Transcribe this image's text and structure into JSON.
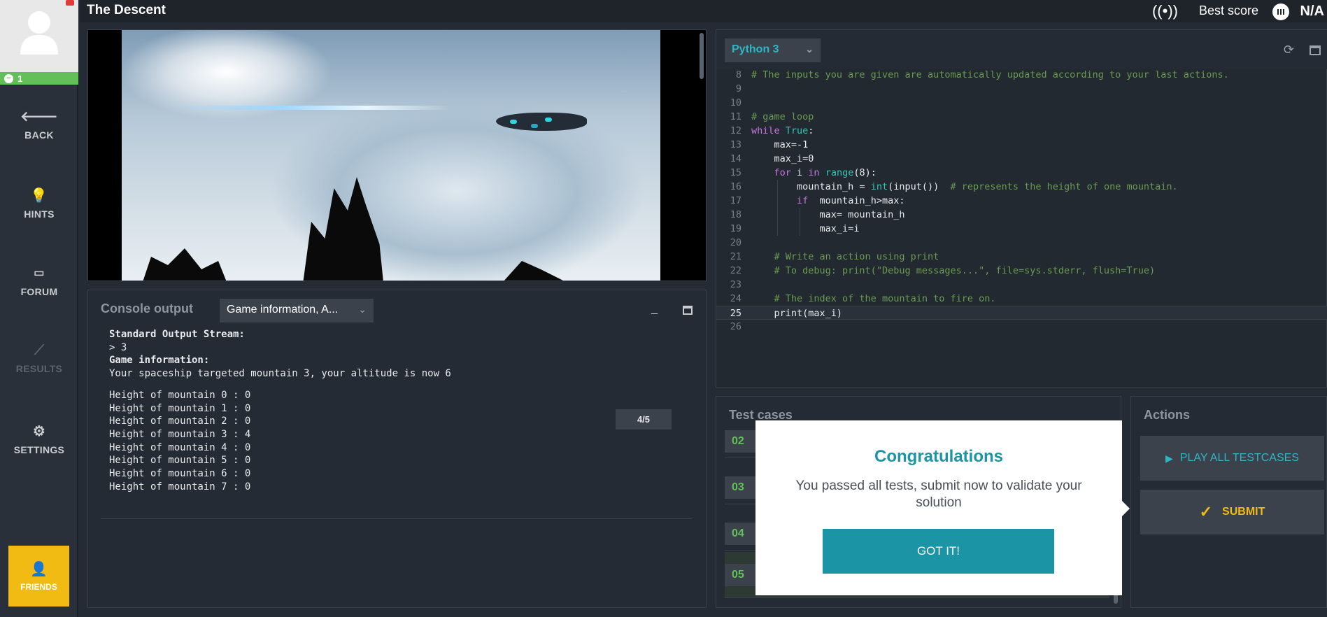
{
  "app": {
    "title": "The Descent"
  },
  "header": {
    "best_score_label": "Best score",
    "best_score_value": "N/A",
    "broadcast_icon": "broadcast-icon",
    "rank_icon": "signal-bars-icon"
  },
  "sidebar": {
    "level": "1",
    "items": [
      {
        "label": "BACK",
        "icon": "arrow-left-icon",
        "enabled": true
      },
      {
        "label": "HINTS",
        "icon": "lightbulb-icon",
        "enabled": true
      },
      {
        "label": "FORUM",
        "icon": "forum-icon",
        "enabled": true
      },
      {
        "label": "RESULTS",
        "icon": "chart-line-icon",
        "enabled": false
      },
      {
        "label": "SETTINGS",
        "icon": "gear-icon",
        "enabled": true
      }
    ],
    "friends_label": "FRIENDS"
  },
  "console": {
    "title": "Console output",
    "filter_value": "Game information, A...",
    "lines": [
      {
        "text": "Standard Output Stream:",
        "bold": true
      },
      {
        "text": "> 3",
        "bold": false
      },
      {
        "text": "Game information:",
        "bold": true
      },
      {
        "text": "Your spaceship targeted mountain 3, your altitude is now 6",
        "bold": false
      },
      {
        "text": "",
        "bold": false
      },
      {
        "text": "Height of mountain 0 : 0",
        "bold": false
      },
      {
        "text": "Height of mountain 1 : 0",
        "bold": false
      },
      {
        "text": "Height of mountain 2 : 0",
        "bold": false
      },
      {
        "text": "Height of mountain 3 : 4",
        "bold": false
      },
      {
        "text": "Height of mountain 4 : 0",
        "bold": false
      },
      {
        "text": "Height of mountain 5 : 0",
        "bold": false
      },
      {
        "text": "Height of mountain 6 : 0",
        "bold": false
      },
      {
        "text": "Height of mountain 7 : 0",
        "bold": false
      }
    ],
    "frame_progress": "4/5"
  },
  "editor": {
    "language": "Python 3",
    "active_line": 25,
    "lines": [
      {
        "n": "8",
        "indent": 0,
        "tokens": [
          [
            "cm",
            "# The inputs you are given are automatically updated according to your last actions."
          ]
        ]
      },
      {
        "n": "9",
        "indent": 0,
        "tokens": []
      },
      {
        "n": "10",
        "indent": 0,
        "tokens": []
      },
      {
        "n": "11",
        "indent": 0,
        "tokens": [
          [
            "cm",
            "# game loop"
          ]
        ]
      },
      {
        "n": "12",
        "indent": 0,
        "tokens": [
          [
            "kw",
            "while "
          ],
          [
            "bi",
            "True"
          ],
          [
            "nm",
            ":"
          ]
        ]
      },
      {
        "n": "13",
        "indent": 1,
        "tokens": [
          [
            "nm",
            "max=-1"
          ]
        ]
      },
      {
        "n": "14",
        "indent": 1,
        "tokens": [
          [
            "nm",
            "max_i=0"
          ]
        ]
      },
      {
        "n": "15",
        "indent": 1,
        "tokens": [
          [
            "kw",
            "for "
          ],
          [
            "nm",
            "i "
          ],
          [
            "kw",
            "in "
          ],
          [
            "bi",
            "range"
          ],
          [
            "nm",
            "(8):"
          ]
        ]
      },
      {
        "n": "16",
        "indent": 2,
        "tokens": [
          [
            "nm",
            "mountain_h = "
          ],
          [
            "bi",
            "int"
          ],
          [
            "nm",
            "(input())  "
          ],
          [
            "cm",
            "# represents the height of one mountain."
          ]
        ]
      },
      {
        "n": "17",
        "indent": 2,
        "tokens": [
          [
            "kw",
            "if "
          ],
          [
            "nm",
            " mountain_h>max:"
          ]
        ]
      },
      {
        "n": "18",
        "indent": 3,
        "tokens": [
          [
            "nm",
            "max= mountain_h"
          ]
        ]
      },
      {
        "n": "19",
        "indent": 3,
        "tokens": [
          [
            "nm",
            "max_i=i"
          ]
        ]
      },
      {
        "n": "20",
        "indent": 0,
        "tokens": []
      },
      {
        "n": "21",
        "indent": 1,
        "tokens": [
          [
            "cm",
            "# Write an action using print"
          ]
        ]
      },
      {
        "n": "22",
        "indent": 1,
        "tokens": [
          [
            "cm",
            "# To debug: print(\"Debug messages...\", file=sys.stderr, flush=True)"
          ]
        ]
      },
      {
        "n": "23",
        "indent": 0,
        "tokens": []
      },
      {
        "n": "24",
        "indent": 1,
        "tokens": [
          [
            "cm",
            "# The index of the mountain to fire on."
          ]
        ]
      },
      {
        "n": "25",
        "indent": 1,
        "tokens": [
          [
            "nm",
            "print(max_i)"
          ]
        ]
      },
      {
        "n": "26",
        "indent": 0,
        "tokens": []
      }
    ]
  },
  "tests": {
    "title": "Test cases",
    "cases": [
      {
        "num": "02",
        "selected": false
      },
      {
        "num": "03",
        "selected": false
      },
      {
        "num": "04",
        "selected": false
      },
      {
        "num": "05",
        "selected": true
      }
    ]
  },
  "popup": {
    "title": "Congratulations",
    "message": "You passed all tests, submit now to validate your solution",
    "button": "GOT IT!"
  },
  "actions": {
    "title": "Actions",
    "play_all_label": "PLAY ALL TESTCASES",
    "submit_label": "SUBMIT"
  }
}
